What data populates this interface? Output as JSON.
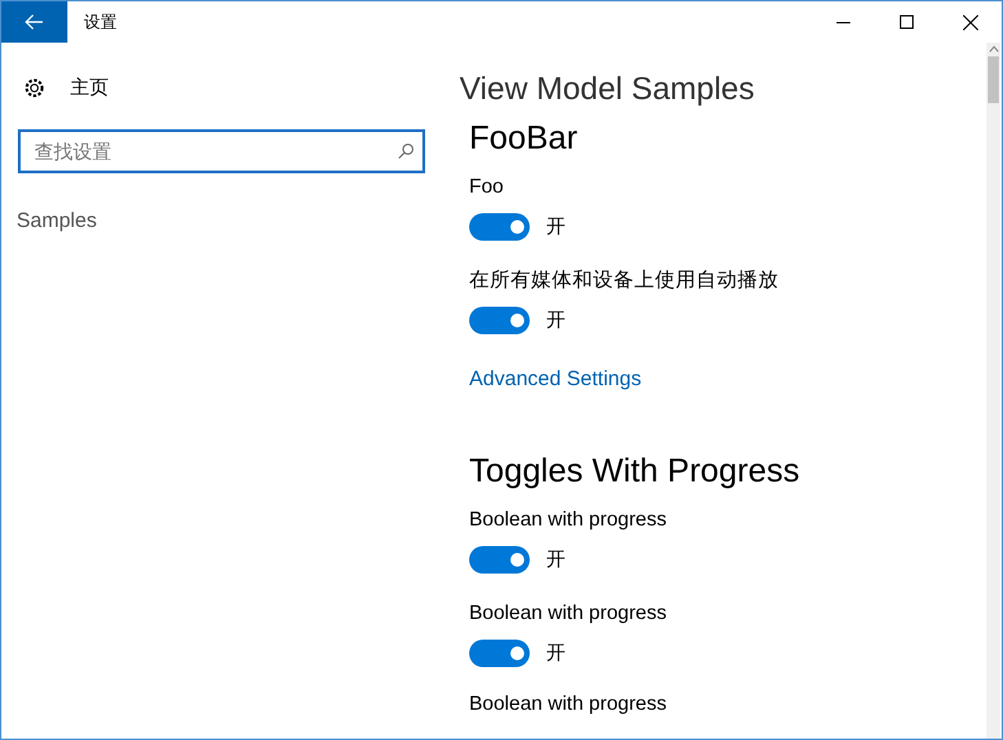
{
  "window": {
    "title": "设置"
  },
  "sidebar": {
    "home_label": "主页",
    "search": {
      "placeholder": "查找设置"
    },
    "items": [
      {
        "label": "Samples",
        "selected": false
      }
    ]
  },
  "content": {
    "page_title": "View Model Samples",
    "sections": [
      {
        "title": "FooBar",
        "items": [
          {
            "kind": "toggle",
            "label": "Foo",
            "on": true,
            "state_label": "开"
          },
          {
            "kind": "toggle",
            "label": "在所有媒体和设备上使用自动播放",
            "on": true,
            "state_label": "开"
          },
          {
            "kind": "link",
            "label": "Advanced Settings"
          }
        ]
      },
      {
        "title": "Toggles With Progress",
        "items": [
          {
            "kind": "toggle",
            "label": "Boolean with progress",
            "on": true,
            "state_label": "开"
          },
          {
            "kind": "toggle",
            "label": "Boolean with progress",
            "on": true,
            "state_label": "开"
          },
          {
            "kind": "label",
            "label": "Boolean with progress"
          }
        ]
      }
    ]
  }
}
